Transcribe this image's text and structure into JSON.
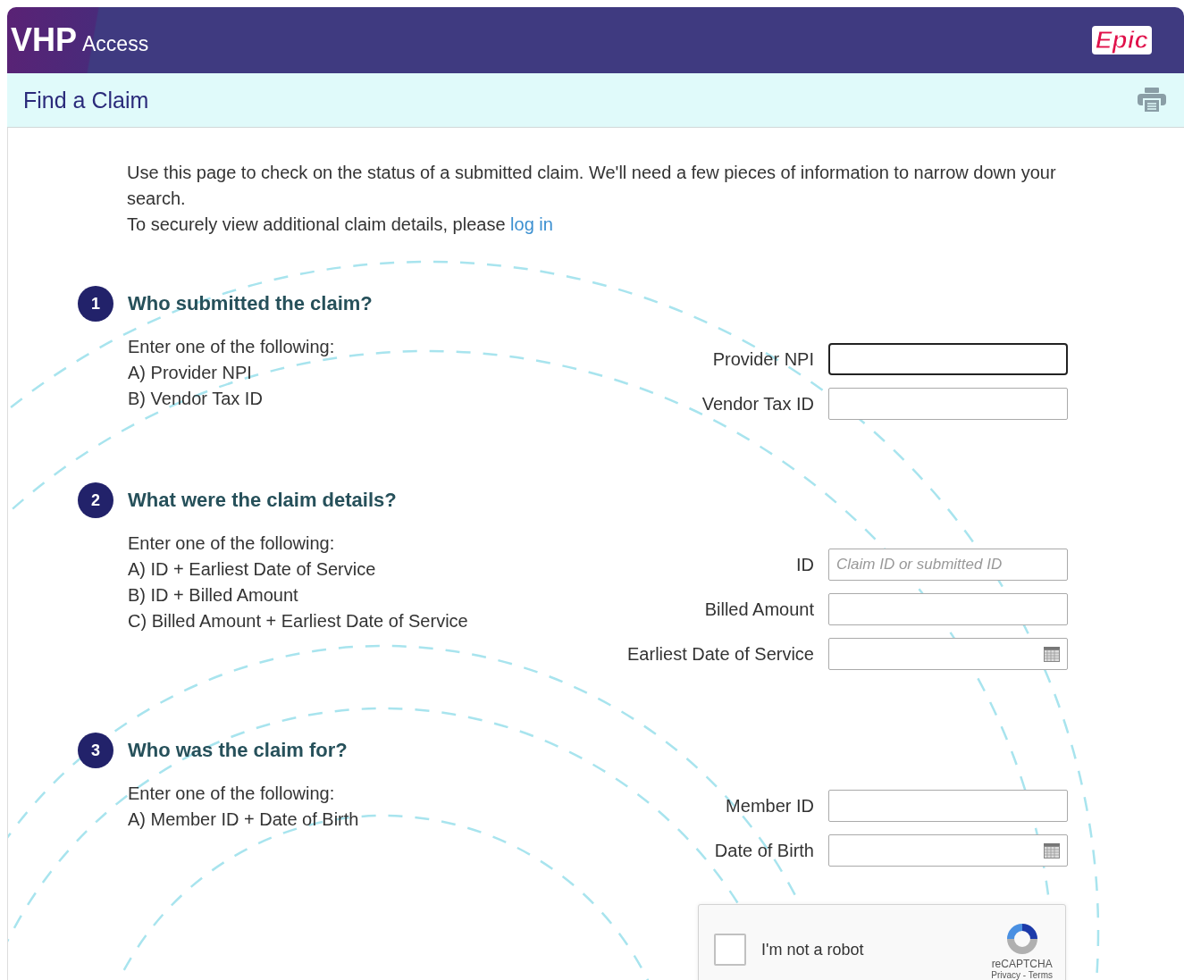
{
  "header": {
    "logo": "VHP",
    "logo_suffix": "Access",
    "brand": "Epic"
  },
  "title": "Find a Claim",
  "intro": {
    "paragraph": "Use this page to check on the status of a submitted claim. We'll need a few pieces of information to narrow down your search.",
    "login_prefix": "To securely view additional claim details, please ",
    "login_link": "log in"
  },
  "sections": [
    {
      "number": "1",
      "heading": "Who submitted the claim?",
      "instructions": [
        "Enter one of the following:",
        "A) Provider NPI",
        "B) Vendor Tax ID"
      ],
      "fields": [
        {
          "label": "Provider NPI",
          "kind": "text",
          "focused": true
        },
        {
          "label": "Vendor Tax ID",
          "kind": "text",
          "focused": false
        }
      ]
    },
    {
      "number": "2",
      "heading": "What were the claim details?",
      "instructions": [
        "Enter one of the following:",
        "A) ID  +  Earliest Date of Service",
        "B) ID  +  Billed Amount",
        "C) Billed Amount  +  Earliest Date of Service"
      ],
      "fields": [
        {
          "label": "ID",
          "kind": "text",
          "focused": false,
          "placeholder": "Claim ID or submitted ID"
        },
        {
          "label": "Billed Amount",
          "kind": "text",
          "focused": false
        },
        {
          "label": "Earliest Date of Service",
          "kind": "date",
          "focused": false
        }
      ]
    },
    {
      "number": "3",
      "heading": "Who was the claim for?",
      "instructions": [
        "Enter one of the following:",
        "A) Member ID  +  Date of Birth"
      ],
      "fields": [
        {
          "label": "Member ID",
          "kind": "text",
          "focused": false
        },
        {
          "label": "Date of Birth",
          "kind": "date",
          "focused": false
        }
      ]
    }
  ],
  "captcha": {
    "label": "I'm not a robot",
    "checked": false,
    "brand": "reCAPTCHA",
    "links": "Privacy - Terms"
  }
}
